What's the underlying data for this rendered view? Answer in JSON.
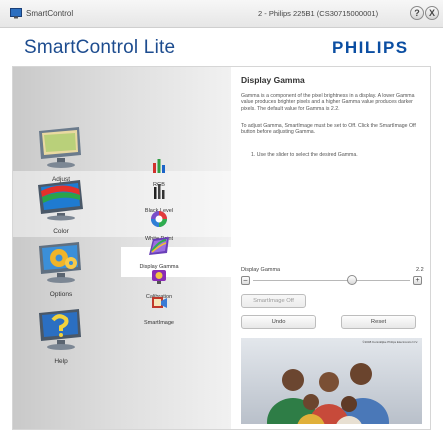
{
  "titlebar": {
    "app_name": "SmartControl",
    "window_title": "2 - Philips 225B1 (CS30715000001)",
    "help_glyph": "?",
    "close_glyph": "X"
  },
  "header": {
    "title": "SmartControl Lite",
    "brand": "PHILIPS"
  },
  "categories": [
    {
      "label": "Adjust",
      "icon": "monitor-adjust-icon"
    },
    {
      "label": "Color",
      "icon": "color-palette-icon"
    },
    {
      "label": "Options",
      "icon": "options-gears-icon"
    },
    {
      "label": "Help",
      "icon": "help-question-icon"
    }
  ],
  "subitems": [
    {
      "label": "RGB",
      "icon": "rgb-bars-icon"
    },
    {
      "label": "Black Level",
      "icon": "black-level-icon"
    },
    {
      "label": "White Point",
      "icon": "white-point-icon"
    },
    {
      "label": "Display Gamma",
      "icon": "display-gamma-icon"
    },
    {
      "label": "Calibration",
      "icon": "calibration-icon"
    },
    {
      "label": "SmartImage",
      "icon": "smartimage-icon"
    }
  ],
  "active_category": "Color",
  "active_subitem": "Display Gamma",
  "content": {
    "title": "Display Gamma",
    "para1": "Gamma is a component of the pixel brightness in a display. A lower Gamma value produces brighter pixels and a higher Gamma value produces darker pixels. The default value for Gamma is 2.2.",
    "para2": "To adjust Gamma, SmartImage must be set to Off. Click the SmartImage Off button before adjusting Gamma.",
    "step1": "1.   Use the slider to select the desired Gamma.",
    "slider": {
      "label": "Display Gamma",
      "value": "2.2",
      "minus": "–",
      "plus": "+",
      "position_fraction": 0.63
    },
    "smartimage_off_label": "SmartImage Off",
    "undo_label": "Undo",
    "reset_label": "Reset",
    "preview_caption": "©2008 Koninklijke Philips Electronics N.V."
  },
  "colors": {
    "brand_blue": "#0b4ea2",
    "title_blue": "#1d4c8f"
  }
}
